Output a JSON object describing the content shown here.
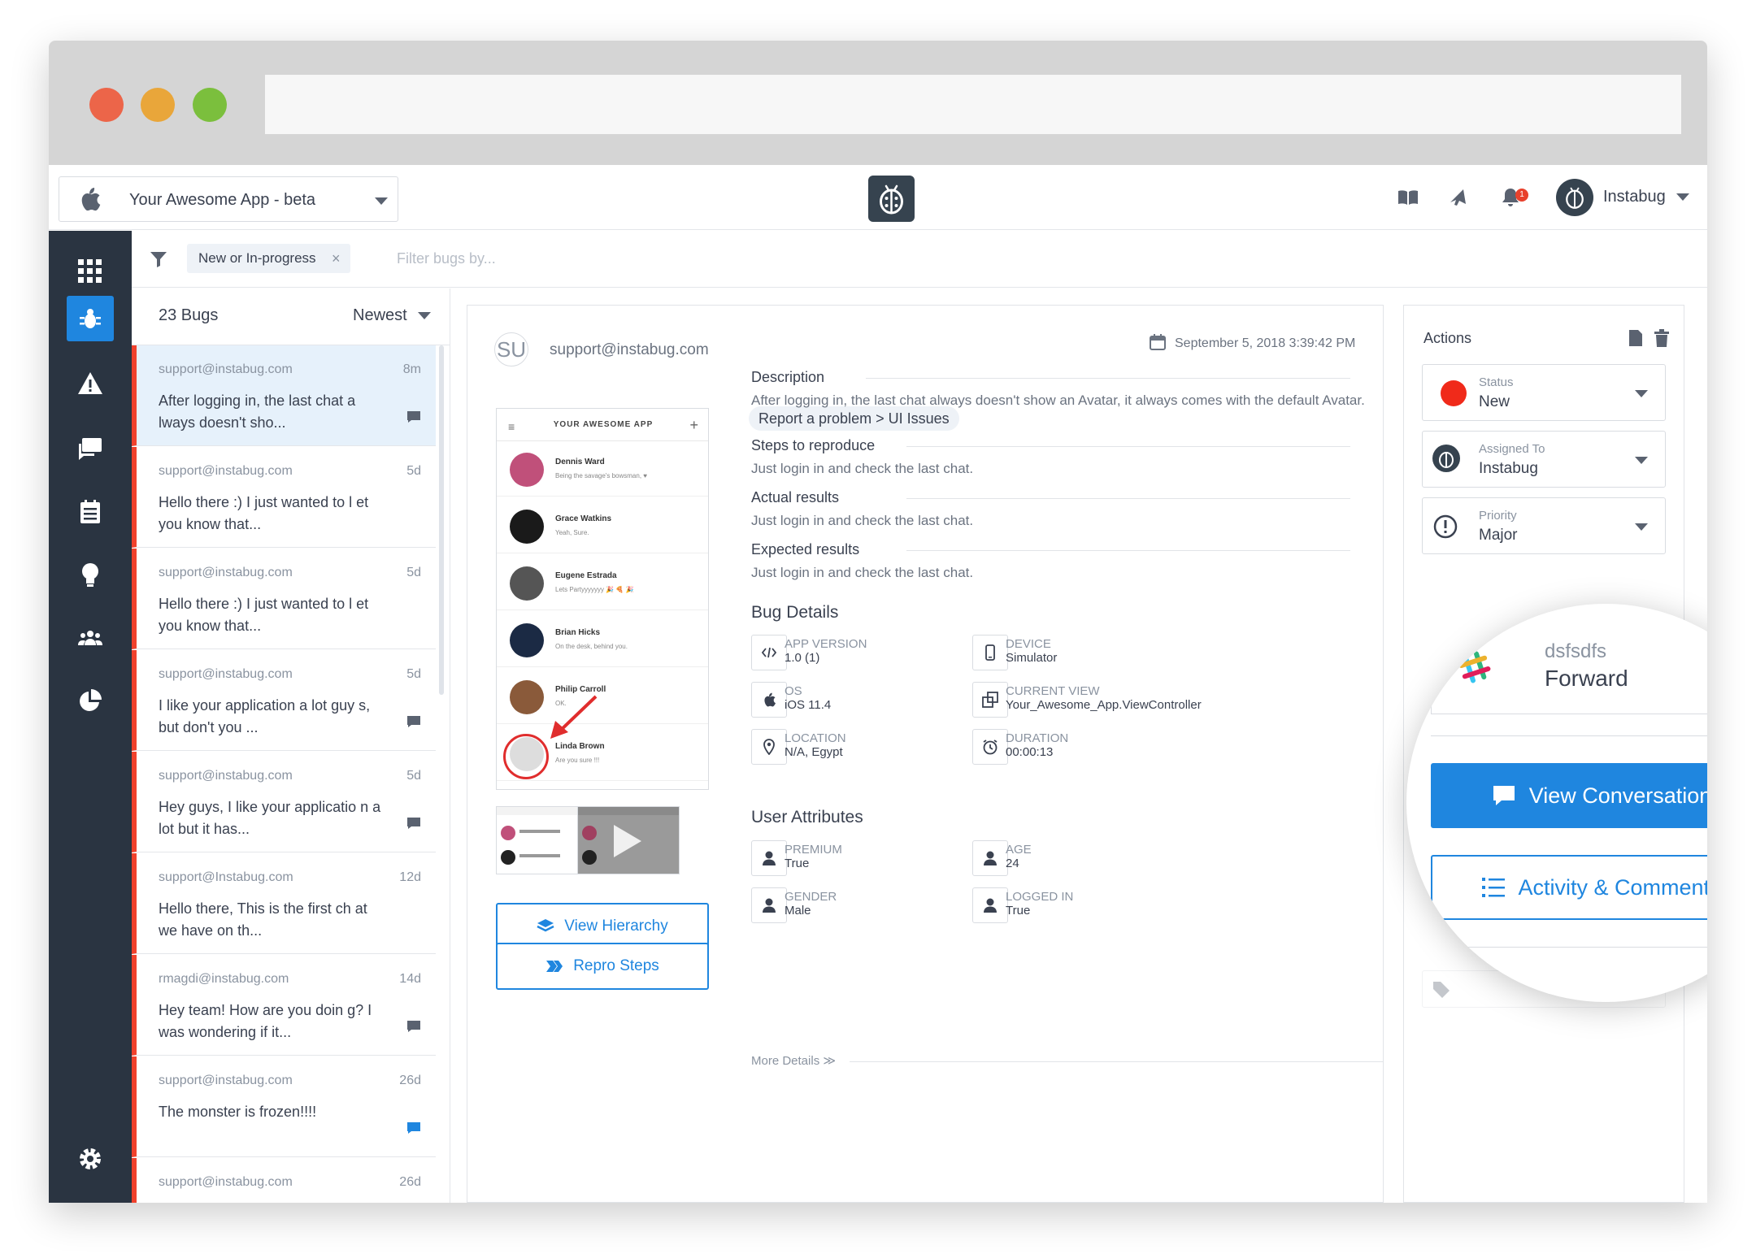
{
  "topbar": {
    "app_name": "Your Awesome App - beta",
    "user_name": "Instabug",
    "notification_count": "1"
  },
  "filter": {
    "chip_label": "New or In-progress",
    "chip_close": "×",
    "placeholder": "Filter bugs by..."
  },
  "list": {
    "count": "23 Bugs",
    "sort": "Newest",
    "items": [
      {
        "email": "support@instabug.com",
        "time": "8m",
        "text": "After logging in, the last chat a lways doesn't sho...",
        "chat": "gray"
      },
      {
        "email": "support@instabug.com",
        "time": "5d",
        "text": "Hello there :) I just wanted to l et you know that...",
        "chat": "none"
      },
      {
        "email": "support@instabug.com",
        "time": "5d",
        "text": "Hello there :) I just wanted to l et you know that...",
        "chat": "none"
      },
      {
        "email": "support@instabug.com",
        "time": "5d",
        "text": "I like your application a lot guy s, but don't you ...",
        "chat": "gray"
      },
      {
        "email": "support@instabug.com",
        "time": "5d",
        "text": "Hey guys, I like your applicatio n a lot but it has...",
        "chat": "gray"
      },
      {
        "email": "support@Instabug.com",
        "time": "12d",
        "text": "Hello there, This is the first ch at we have on th...",
        "chat": "none"
      },
      {
        "email": "rmagdi@instabug.com",
        "time": "14d",
        "text": "Hey team! How are you doin g? I was wondering if it...",
        "chat": "gray"
      },
      {
        "email": "support@instabug.com",
        "time": "26d",
        "text": "The monster is frozen!!!!",
        "chat": "blue"
      },
      {
        "email": "support@instabug.com",
        "time": "26d",
        "text": "",
        "chat": "none"
      }
    ]
  },
  "report": {
    "avatar_initials": "SU",
    "reporter": "support@instabug.com",
    "date": "September 5, 2018 3:39:42 PM",
    "category": "Report a problem > UI Issues",
    "sections": [
      {
        "title": "Description",
        "text": "After logging in, the last chat always doesn't show an Avatar, it always comes with the default Avatar."
      },
      {
        "title": "Steps to reproduce",
        "text": "Just login in and check the last chat."
      },
      {
        "title": "Actual results",
        "text": "Just login in and check the last chat."
      },
      {
        "title": "Expected results",
        "text": "Just login in and check the last chat."
      }
    ],
    "bug_details_title": "Bug Details",
    "details": [
      {
        "label": "APP VERSION",
        "value": "1.0 (1)",
        "icon": "code-icon"
      },
      {
        "label": "DEVICE",
        "value": "Simulator",
        "icon": "phone-icon"
      },
      {
        "label": "OS",
        "value": "iOS 11.4",
        "icon": "apple-icon"
      },
      {
        "label": "CURRENT VIEW",
        "value": "Your_Awesome_App.ViewController",
        "icon": "view-icon"
      },
      {
        "label": "LOCATION",
        "value": "N/A, Egypt",
        "icon": "location-icon"
      },
      {
        "label": "DURATION",
        "value": "00:00:13",
        "icon": "clock-icon"
      }
    ],
    "more_details": "More Details ≫",
    "user_attributes_title": "User Attributes",
    "attributes": [
      {
        "label": "PREMIUM",
        "value": "True"
      },
      {
        "label": "AGE",
        "value": "24"
      },
      {
        "label": "GENDER",
        "value": "Male"
      },
      {
        "label": "LOGGED IN",
        "value": "True"
      }
    ],
    "view_hierarchy": "View Hierarchy",
    "repro_steps": "Repro Steps"
  },
  "screenshot": {
    "title": "YOUR AWESOME APP",
    "contacts": [
      {
        "name": "Dennis Ward",
        "msg": "Being the savage's bowsman, ♥"
      },
      {
        "name": "Grace Watkins",
        "msg": "Yeah, Sure."
      },
      {
        "name": "Eugene Estrada",
        "msg": "Lets Partyyyyyyy 🎉 🍕 🎉"
      },
      {
        "name": "Brian Hicks",
        "msg": "On the desk, behind you."
      },
      {
        "name": "Philip Carroll",
        "msg": "OK."
      },
      {
        "name": "Linda Brown",
        "msg": "Are you sure !!!"
      }
    ]
  },
  "actions": {
    "title": "Actions",
    "status_label": "Status",
    "status_value": "New",
    "status_color": "#f02a1a",
    "assigned_label": "Assigned To",
    "assigned_value": "Instabug",
    "priority_label": "Priority",
    "priority_value": "Major",
    "integration_sub": "dsfsdfs",
    "integration_action": "Forward",
    "view_conversation": "View Conversation",
    "activity_comments": "Activity & Comments"
  },
  "colors": {
    "accent": "#1f86df",
    "sidebar": "#2a3441",
    "bug_marker": "#f0412c"
  }
}
